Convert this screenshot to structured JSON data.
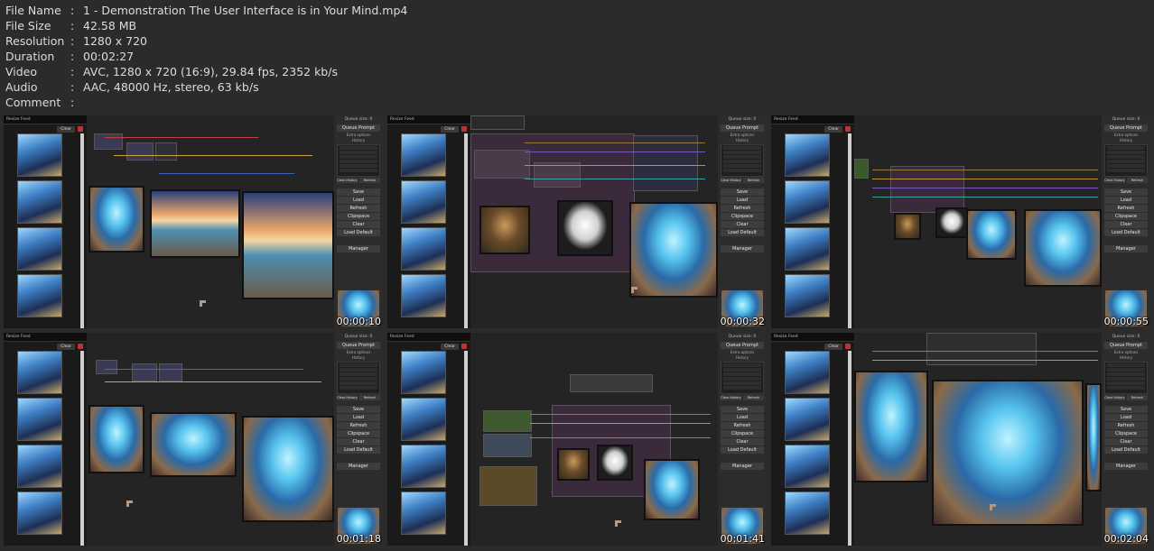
{
  "meta": [
    {
      "key": "File Name",
      "value": "1 - Demonstration The User Interface is in Your Mind.mp4"
    },
    {
      "key": "File Size",
      "value": "42.58 MB"
    },
    {
      "key": "Resolution",
      "value": "1280 x 720"
    },
    {
      "key": "Duration",
      "value": "00:02:27"
    },
    {
      "key": "Video",
      "value": "AVC, 1280 x 720 (16:9), 29.84 fps, 2352 kb/s"
    },
    {
      "key": "Audio",
      "value": "AAC, 48000 Hz, stereo, 63 kb/s"
    },
    {
      "key": "Comment",
      "value": ""
    }
  ],
  "separator": ":",
  "ui": {
    "feed_title": "Resize Feed",
    "feed_clear": "Clear",
    "queue_size": "Queue size: 0",
    "queue_prompt": "Queue Prompt",
    "extra_options": "Extra options",
    "history": "History",
    "clear_history": "Clear History",
    "refresh_small": "Refresh",
    "buttons": [
      "Save",
      "Load",
      "Refresh",
      "Clipspace",
      "Clear",
      "Load Default"
    ],
    "manager": "Manager"
  },
  "thumbnails": [
    {
      "timestamp": "00:00:10",
      "scene": "landscapes"
    },
    {
      "timestamp": "00:00:32",
      "scene": "mask-workflow"
    },
    {
      "timestamp": "00:00:55",
      "scene": "mask-workflow-zoomed"
    },
    {
      "timestamp": "00:01:18",
      "scene": "portraits"
    },
    {
      "timestamp": "00:01:41",
      "scene": "nodes-overview"
    },
    {
      "timestamp": "00:02:04",
      "scene": "portraits-large"
    }
  ]
}
